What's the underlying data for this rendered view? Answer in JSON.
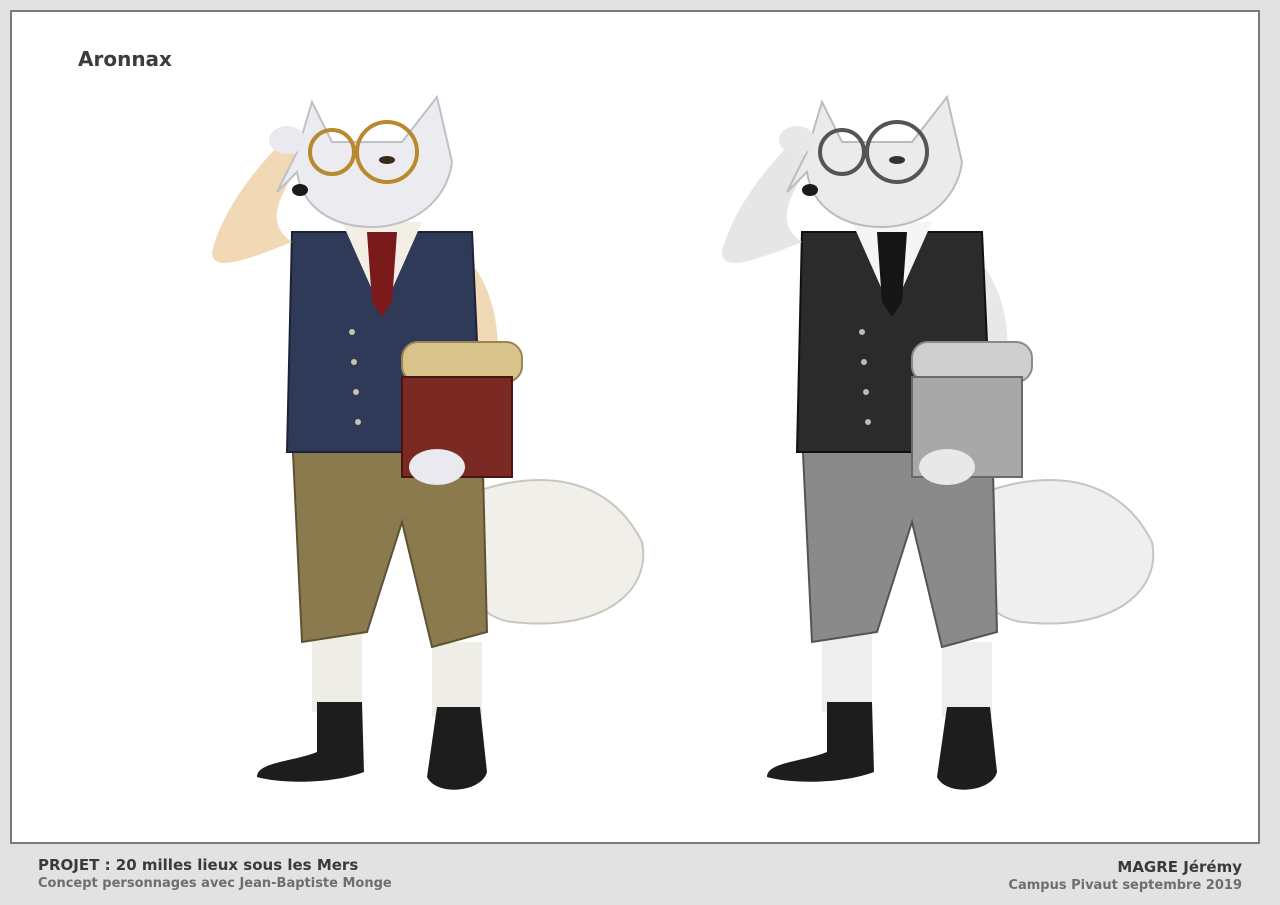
{
  "sheet": {
    "title": "Aronnax"
  },
  "figures": [
    {
      "name": "aronnax-color",
      "palette": "color"
    },
    {
      "name": "aronnax-grayscale",
      "palette": "grayscale"
    }
  ],
  "footer": {
    "project": "PROJET : 20 milles lieux sous les Mers",
    "subtitle": "Concept personnages avec Jean-Baptiste Monge",
    "author": "MAGRE Jérémy",
    "school": "Campus Pivaut septembre 2019"
  },
  "colors": {
    "frame_border": "#7a7a7a",
    "background": "#e2e2e2",
    "vest_color": "#2f3a58",
    "pants_color": "#8a7a4e",
    "tie_color": "#7a1a1a",
    "book_color": "#7a2a22",
    "scroll_color": "#d8c48a"
  }
}
